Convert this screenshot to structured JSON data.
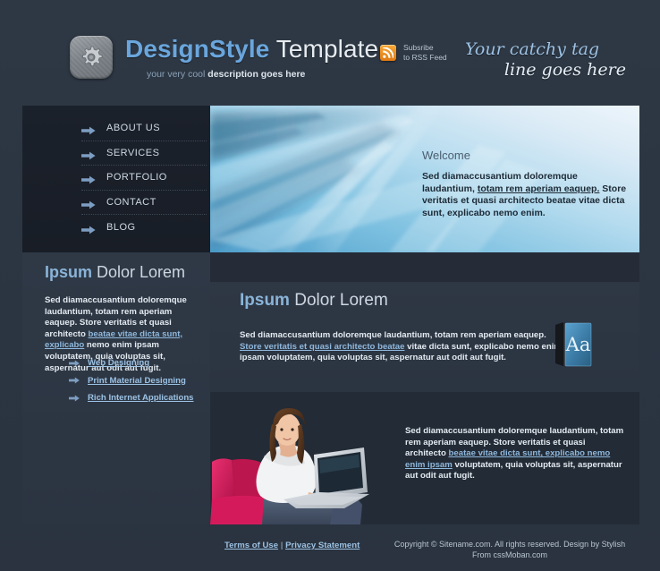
{
  "header": {
    "logo_icon": "gear-icon",
    "brand_strong": "DesignStyle",
    "brand_light": " Template",
    "tagline_prefix": "your very cool ",
    "tagline_strong": "description goes here",
    "rss_icon": "rss-feed-icon",
    "rss_line1": "Subsribe",
    "rss_line2": "to RSS Feed",
    "catchy_line1": "Your catchy tag",
    "catchy_line2": "line goes here"
  },
  "nav": {
    "items": [
      {
        "label": "ABOUT US",
        "icon": "arrow-right-icon"
      },
      {
        "label": "SERVICES",
        "icon": "arrow-right-icon"
      },
      {
        "label": "PORTFOLIO",
        "icon": "arrow-right-icon"
      },
      {
        "label": "CONTACT",
        "icon": "arrow-right-icon"
      },
      {
        "label": "BLOG",
        "icon": "arrow-right-icon"
      }
    ]
  },
  "banner": {
    "image_alt": "abstract-blue-light-streaks",
    "welcome_title": "Welcome",
    "welcome_text_1": "Sed diamaccusantium doloremque laudantium, ",
    "welcome_link": "totam rem aperiam eaquep.",
    "welcome_text_2": " Store veritatis et quasi architecto beatae vitae dicta sunt, explicabo nemo enim."
  },
  "sidebar": {
    "heading_strong": "Ipsum",
    "heading_light": " Dolor Lorem",
    "body_text_1": "Sed diamaccusantium doloremque laudantium, totam rem aperiam eaquep. Store veritatis et quasi architecto ",
    "body_link": "beatae vitae dicta sunt, explicabo",
    "body_text_2": " nemo enim ipsam voluptatem, quia voluptas sit, aspernatur aut odit aut fugit.",
    "links": [
      {
        "label": "Web Designing",
        "icon": "arrow-right-icon"
      },
      {
        "label": "Print Material Designing",
        "icon": "arrow-right-icon"
      },
      {
        "label": "Rich Internet Applications",
        "icon": "arrow-right-icon"
      }
    ]
  },
  "content": {
    "heading_strong": "Ipsum",
    "heading_light": " Dolor Lorem",
    "body_text_1": "Sed diamaccusantium doloremque laudantium, totam rem aperiam eaquep. ",
    "body_link": "Store veritatis et quasi architecto beatae",
    "body_text_2": " vitae dicta sunt, explicabo nemo enim ipsam voluptatem, quia voluptas sit, aspernatur aut odit aut fugit.",
    "book_icon": "dictionary-book-icon",
    "book_glyph": "Aa"
  },
  "feature": {
    "photo_alt": "woman-with-laptop-on-pink-chair",
    "body_text_1": "Sed diamaccusantium doloremque laudantium, totam rem aperiam eaquep. Store veritatis et quasi architecto ",
    "body_link": "beatae vitae dicta sunt, explicabo nemo enim ipsam",
    "body_text_2": " voluptatem, quia voluptas sit, aspernatur aut odit aut fugit."
  },
  "footer": {
    "terms_label": "Terms of Use",
    "separator": " | ",
    "privacy_label": "Privacy Statement",
    "copyright": "Copyright © Sitename.com. All rights reserved. Design by Stylish From cssMoban.com"
  },
  "colors": {
    "page_bg": "#2b3542",
    "nav_bg": "#1b212b",
    "panel_bg": "#2e3744",
    "dark_bar": "#252c38",
    "accent_blue": "#6aa6dd",
    "link_blue": "#9cc2e4",
    "rss_orange": "#e07a12",
    "chair_pink": "#d81b60"
  }
}
